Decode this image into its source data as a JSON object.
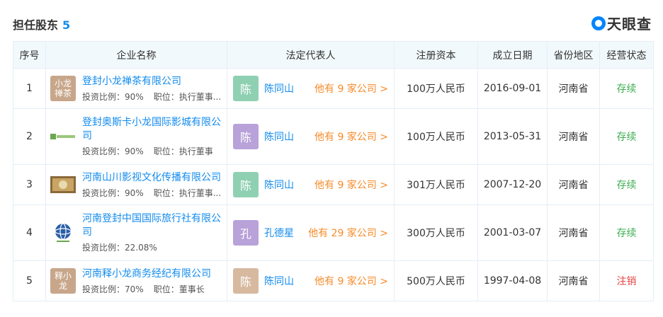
{
  "header": {
    "title": "担任股东",
    "count": "5",
    "logo_text": "天眼查"
  },
  "columns": [
    "序号",
    "企业名称",
    "法定代表人",
    "注册资本",
    "成立日期",
    "省份地区",
    "经营状态"
  ],
  "rows": [
    {
      "index": "1",
      "logo_text": "小龙禅茶",
      "company": "登封小龙禅茶有限公司",
      "invest": "投资比例：90%",
      "position": "职位：执行董事...",
      "rep_avatar": "陈",
      "rep_avatar_color": "#8fd0b2",
      "rep_name": "陈同山",
      "rep_more": "他有 9 家公司 >",
      "capital": "100万人民币",
      "date": "2016-09-01",
      "region": "河南省",
      "status": "存续"
    },
    {
      "index": "2",
      "logo_text": "",
      "company": "登封奥斯卡小龙国际影城有限公司",
      "invest": "投资比例：90%",
      "position": "职位：执行董事",
      "rep_avatar": "陈",
      "rep_avatar_color": "#b8a2d9",
      "rep_name": "陈同山",
      "rep_more": "他有 9 家公司 >",
      "capital": "100万人民币",
      "date": "2013-05-31",
      "region": "河南省",
      "status": "存续"
    },
    {
      "index": "3",
      "logo_text": "",
      "company": "河南山川影视文化传播有限公司",
      "invest": "投资比例：90%",
      "position": "职位：执行董事...",
      "rep_avatar": "陈",
      "rep_avatar_color": "#8fd0b2",
      "rep_name": "陈同山",
      "rep_more": "他有 9 家公司 >",
      "capital": "301万人民币",
      "date": "2007-12-20",
      "region": "河南省",
      "status": "存续"
    },
    {
      "index": "4",
      "logo_text": "",
      "company": "河南登封中国国际旅行社有限公司",
      "invest": "投资比例：22.08%",
      "position": "",
      "rep_avatar": "孔",
      "rep_avatar_color": "#b8a2d9",
      "rep_name": "孔德星",
      "rep_more": "他有 29 家公司 >",
      "capital": "300万人民币",
      "date": "2001-03-07",
      "region": "河南省",
      "status": "存续"
    },
    {
      "index": "5",
      "logo_text": "释小龙",
      "company": "河南释小龙商务经纪有限公司",
      "invest": "投资比例：70%",
      "position": "职位：董事长",
      "rep_avatar": "陈",
      "rep_avatar_color": "#d7b9a0",
      "rep_name": "陈同山",
      "rep_more": "他有 9 家公司 >",
      "capital": "500万人民币",
      "date": "1997-04-08",
      "region": "河南省",
      "status": "注销"
    }
  ]
}
